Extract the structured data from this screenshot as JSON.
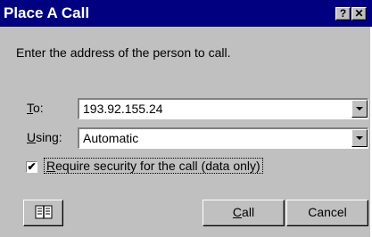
{
  "window": {
    "title": "Place A Call",
    "help_button": "?",
    "close_button": "✕"
  },
  "instruction": "Enter the address of the person to call.",
  "to": {
    "label_mnemonic": "T",
    "label_rest": "o:",
    "value": "193.92.155.24"
  },
  "using": {
    "label_mnemonic": "U",
    "label_rest": "sing:",
    "value": "Automatic"
  },
  "security": {
    "checked": true,
    "label_mnemonic": "R",
    "label_rest": "equire security for the call (data only)"
  },
  "buttons": {
    "address_book_icon": "address-book-icon",
    "call_mnemonic": "C",
    "call_rest": "all",
    "cancel": "Cancel"
  }
}
